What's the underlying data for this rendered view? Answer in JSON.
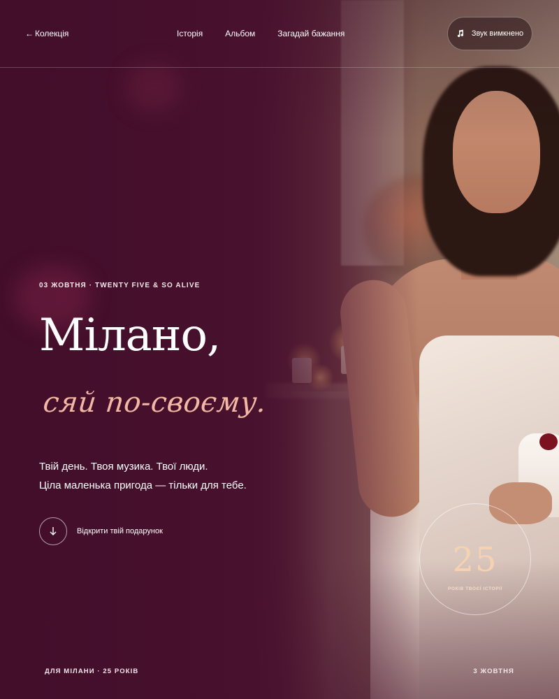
{
  "header": {
    "back_label": "Колекція",
    "nav": [
      "Історія",
      "Альбом",
      "Загадай бажання"
    ],
    "sound_label": "Звук вимкнено"
  },
  "hero": {
    "eyebrow": "03 ЖОВТНЯ · TWENTY FIVE & SO ALIVE",
    "title": "Мілано,",
    "subtitle": "сяй по-своєму.",
    "lead_line1": "Твій день. Твоя музика. Твої люди.",
    "lead_line2": "Ціла маленька пригода — тільки для тебе.",
    "cta_label": "Відкрити твій подарунок"
  },
  "badge": {
    "number": "25",
    "caption": "РОКІВ ТВОЄЇ ІСТОРІЇ"
  },
  "footer": {
    "left": "ДЛЯ МІЛАНИ · 25 РОКІВ",
    "right": "3 ЖОВТНЯ"
  },
  "colors": {
    "background": "#46112d",
    "accent": "#f2b8a4",
    "badge_text": "#f6d2b3"
  }
}
